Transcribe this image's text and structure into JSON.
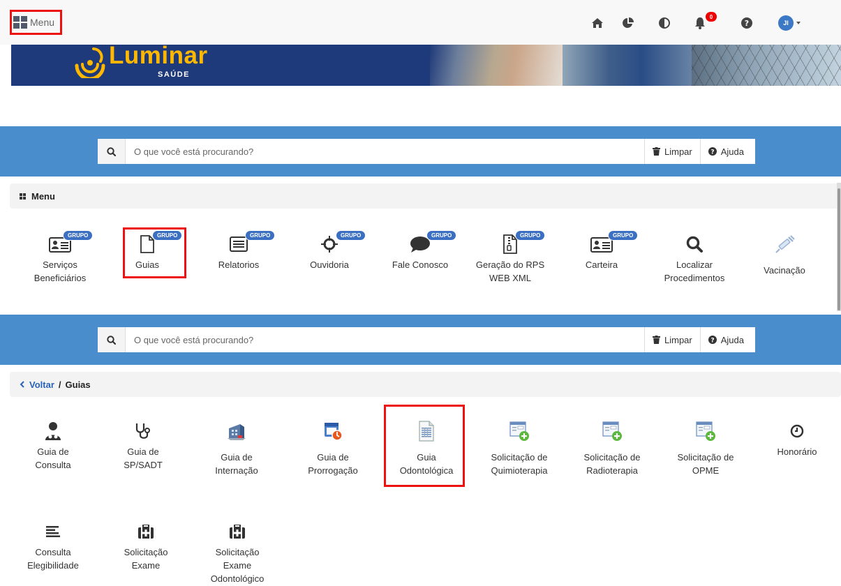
{
  "topbar": {
    "menu_label": "Menu",
    "bell_count": "0",
    "avatar_initials": "JI"
  },
  "banner": {
    "logo_text": "Luminar",
    "logo_sub": "SAÚDE"
  },
  "search": {
    "placeholder": "O que você está procurando?",
    "clear_label": "Limpar",
    "help_label": "Ajuda"
  },
  "menu_section": {
    "title": "Menu",
    "items": [
      {
        "label1": "Serviços",
        "label2": "Beneficiários",
        "badge": "GRUPO",
        "icon": "id-card-icon"
      },
      {
        "label1": "Guias",
        "label2": "",
        "badge": "GRUPO",
        "icon": "document-icon"
      },
      {
        "label1": "Relatorios",
        "label2": "",
        "badge": "GRUPO",
        "icon": "list-icon"
      },
      {
        "label1": "Ouvidoria",
        "label2": "",
        "badge": "GRUPO",
        "icon": "crosshair-icon"
      },
      {
        "label1": "Fale Conosco",
        "label2": "",
        "badge": "GRUPO",
        "icon": "chat-icon"
      },
      {
        "label1": "Geração do RPS",
        "label2": "WEB XML",
        "badge": "GRUPO",
        "icon": "zip-file-icon"
      },
      {
        "label1": "Carteira",
        "label2": "",
        "badge": "GRUPO",
        "icon": "id-card-icon"
      },
      {
        "label1": "Localizar",
        "label2": "Procedimentos",
        "badge": "",
        "icon": "search-icon"
      },
      {
        "label1": "Vacinação",
        "label2": "",
        "badge": "",
        "icon": "syringe-icon"
      }
    ]
  },
  "guias_section": {
    "back_label": "Voltar",
    "separator": "/",
    "current": "Guias",
    "items": [
      {
        "label1": "Guia de",
        "label2": "Consulta",
        "label3": "",
        "icon": "doctor-icon"
      },
      {
        "label1": "Guia de",
        "label2": "SP/SADT",
        "label3": "",
        "icon": "stethoscope-icon"
      },
      {
        "label1": "Guia de",
        "label2": "Internação",
        "label3": "",
        "icon": "hospital-icon"
      },
      {
        "label1": "Guia de",
        "label2": "Prorrogação",
        "label3": "",
        "icon": "calendar-clock-icon"
      },
      {
        "label1": "Guia",
        "label2": "Odontológica",
        "label3": "",
        "icon": "spreadsheet-doc-icon"
      },
      {
        "label1": "Solicitação de",
        "label2": "Quimioterapia",
        "label3": "",
        "icon": "form-add-icon"
      },
      {
        "label1": "Solicitação de",
        "label2": "Radioterapia",
        "label3": "",
        "icon": "form-add-icon"
      },
      {
        "label1": "Solicitação de",
        "label2": "OPME",
        "label3": "",
        "icon": "form-add-icon"
      },
      {
        "label1": "Honorário",
        "label2": "",
        "label3": "",
        "icon": "clock-icon"
      },
      {
        "label1": "Consulta",
        "label2": "Elegibilidade",
        "label3": "",
        "icon": "align-left-icon"
      },
      {
        "label1": "Solicitação",
        "label2": "Exame",
        "label3": "",
        "icon": "medkit-icon"
      },
      {
        "label1": "Solicitação",
        "label2": "Exame",
        "label3": "Odontológico",
        "icon": "medkit-icon"
      }
    ]
  },
  "colors": {
    "search_band": "#4a8dcc",
    "banner": "#1f3a7a",
    "highlight": "#e11111",
    "badge": "#3b6fc2",
    "link": "#2a62b7"
  }
}
